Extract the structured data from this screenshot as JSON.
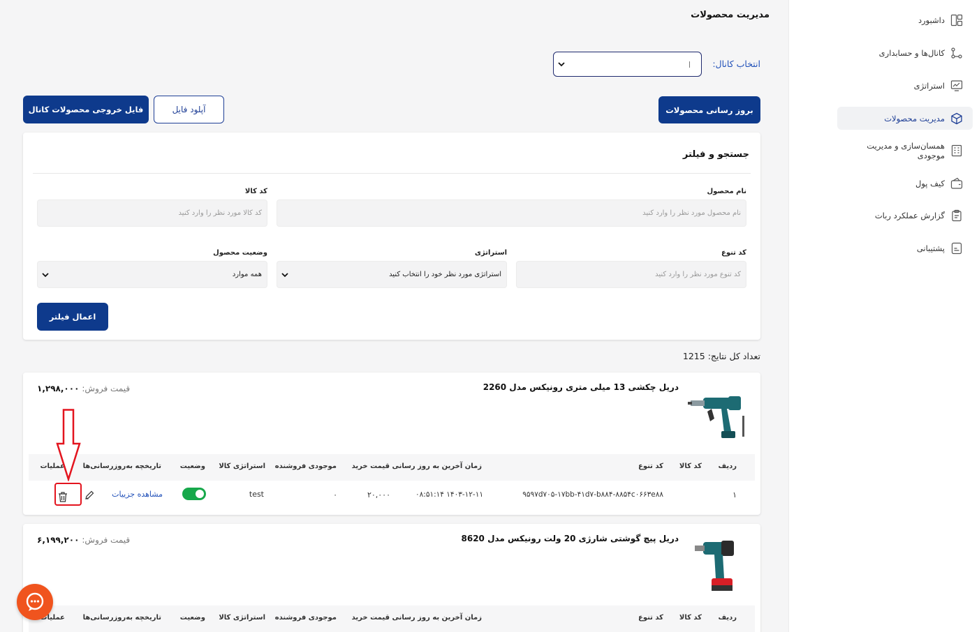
{
  "sidebar": {
    "items": [
      {
        "label": "داشبورد",
        "icon": "dashboard-icon",
        "active": false
      },
      {
        "label": "کانال‌ها و حسابداری",
        "icon": "channels-icon",
        "active": false
      },
      {
        "label": "استراتژی",
        "icon": "strategy-icon",
        "active": false
      },
      {
        "label": "مدیریت محصولات",
        "icon": "box-icon",
        "active": true
      },
      {
        "label": "همسان‌سازی و مدیریت موجودی",
        "icon": "building-icon",
        "active": false
      },
      {
        "label": "کیف پول",
        "icon": "wallet-icon",
        "active": false
      },
      {
        "label": "گزارش عملکرد ربات",
        "icon": "clipboard-icon",
        "active": false
      },
      {
        "label": "پشتیبانی",
        "icon": "document-icon",
        "active": false
      }
    ]
  },
  "header": {
    "title": "مدیریت محصولات",
    "channel_label": "انتخاب کانال:",
    "channel_value": ""
  },
  "toolbar": {
    "update_label": "بروز رسانی محصولات",
    "upload_label": "آپلود فایل",
    "export_label": "فایل خروجی محصولات کانال"
  },
  "filter": {
    "title": "جستجو و فیلتر",
    "product_name_label": "نام محصول",
    "product_name_placeholder": "نام محصول مورد نظر را وارد کنید",
    "product_code_label": "کد کالا",
    "product_code_placeholder": "کد کالا مورد نظر را وارد کنید",
    "variant_code_label": "کد تنوع",
    "variant_code_placeholder": "کد تنوع مورد نظر را وارد کنید",
    "strategy_label": "استراتژی",
    "strategy_value": "استراتژی مورد نظر خود را انتخاب کنید",
    "status_label": "وضعیت محصول",
    "status_value": "همه موارد",
    "apply_label": "اعمال فیلتر"
  },
  "results": {
    "total_label": "تعداد کل نتایج: 1215"
  },
  "table_headers": {
    "row": "ردیف",
    "product_code": "کد کالا",
    "variant_code": "کد تنوع",
    "last_update": "زمان آخرین به روز رسانی",
    "buy_price": "قیمت خرید",
    "seller_stock": "موجودی فروشنده",
    "strategy": "استراتژی کالا",
    "status": "وضعیت",
    "history": "تاریخچه به‌روزرسانی‌ها",
    "actions": "عملیات"
  },
  "products": [
    {
      "title": "دریل چکشی 13 میلی متری رونیکس مدل 2260",
      "price_label": "قیمت فروش:",
      "price": "۱,۲۹۸,۰۰۰",
      "row": {
        "index": "۱",
        "product_code": "",
        "variant_code": "۹۵۹۷d۷۰۵-۱۷bb-۴۱d۷-b۸۸۴-۸۸۵۴c۰۶۶۳e۸۸",
        "last_update": "۱۴۰۳-۱۲-۱۱ ۰۸:۵۱:۱۴",
        "buy_price": "۲۰,۰۰۰",
        "seller_stock": "۰",
        "strategy": "test",
        "status_on": true,
        "history_link": "مشاهده جزییات"
      }
    },
    {
      "title": "دریل پیچ گوشتی شارژی 20 ولت رونیکس مدل 8620",
      "price_label": "قیمت فروش:",
      "price": "۶,۱۹۹,۲۰۰"
    }
  ],
  "colors": {
    "primary": "#0e3a8c",
    "link": "#1f4fb8",
    "toggle_on": "#17a84b",
    "highlight": "#e3141e",
    "chat": "#f0541e"
  }
}
